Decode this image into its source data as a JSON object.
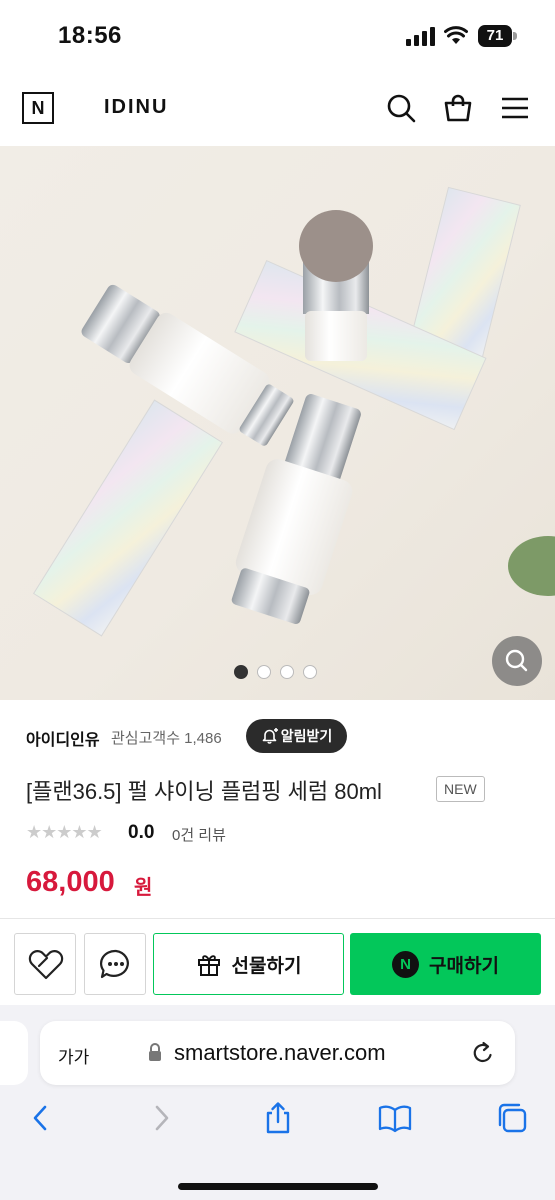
{
  "status_bar": {
    "time": "18:56",
    "battery": "71"
  },
  "header": {
    "brand_badge": "N",
    "brand_name": "IDINU"
  },
  "gallery": {
    "slide_count": 4,
    "active_slide": 1
  },
  "product": {
    "seller": "아이디인유",
    "fans_label": "관심고객수 1,486",
    "alert_label": "알림받기",
    "title": "[플랜36.5] 펄 샤이닝 플럼핑 세럼 80ml",
    "badge": "NEW",
    "stars": "★★★★★",
    "rating": "0.0",
    "reviews": "0건 리뷰",
    "price": "68,000",
    "price_unit": "원"
  },
  "actions": {
    "gift_label": "선물하기",
    "buy_label": "구매하기",
    "buy_icon_letter": "N"
  },
  "browser": {
    "text_size_label": "가가",
    "url": "smartstore.naver.com"
  },
  "colors": {
    "price": "#d7193c",
    "naver_green": "#03c75a"
  }
}
